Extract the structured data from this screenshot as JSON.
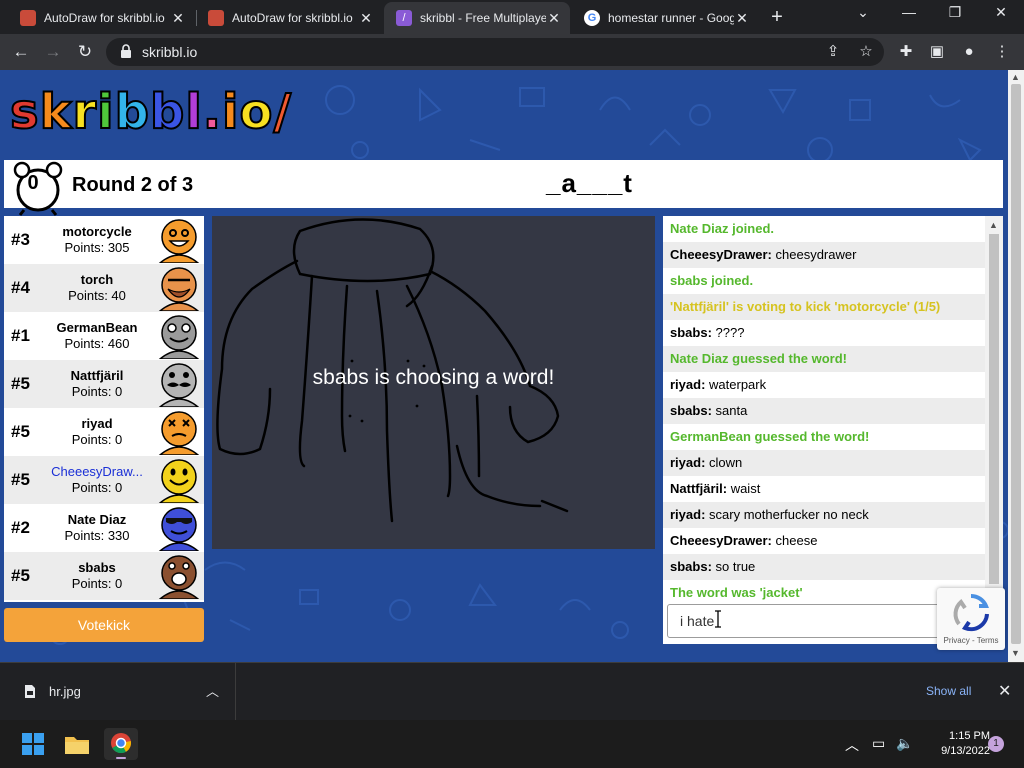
{
  "browser": {
    "tabs": [
      {
        "title": "AutoDraw for skribbl.io",
        "active": false
      },
      {
        "title": "AutoDraw for skribbl.io",
        "active": false
      },
      {
        "title": "skribbl - Free Multiplayer",
        "active": true
      },
      {
        "title": "homestar runner - Google",
        "active": false
      }
    ],
    "url": "skribbl.io"
  },
  "game": {
    "timer": "0",
    "round_text": "Round 2 of 3",
    "word_hint": "_a___t",
    "status_text": "sbabs is choosing a word!",
    "votekick_label": "Votekick",
    "chat_input_value": "i hate"
  },
  "players": [
    {
      "rank": "#3",
      "name": "motorcycle",
      "points": "Points: 305",
      "avatar_color": "#f59c2d",
      "avatar": "laughing-avatar"
    },
    {
      "rank": "#4",
      "name": "torch",
      "points": "Points: 40",
      "avatar_color": "#e8924a",
      "avatar": "bearded-avatar"
    },
    {
      "rank": "#1",
      "name": "GermanBean",
      "points": "Points: 460",
      "avatar_color": "#9a9a9a",
      "avatar": "grinning-avatar"
    },
    {
      "rank": "#5",
      "name": "Nattfjäril",
      "points": "Points: 0",
      "avatar_color": "#b4b4b4",
      "avatar": "mustache-avatar"
    },
    {
      "rank": "#5",
      "name": "riyad",
      "points": "Points: 0",
      "avatar_color": "#f59c2d",
      "avatar": "dizzy-avatar"
    },
    {
      "rank": "#5",
      "name": "CheeesyDraw...",
      "points": "Points: 0",
      "avatar_color": "#f2d21b",
      "avatar": "smiling-avatar",
      "self": true
    },
    {
      "rank": "#2",
      "name": "Nate Diaz",
      "points": "Points: 330",
      "avatar_color": "#3f4fd8",
      "avatar": "sunglasses-avatar"
    },
    {
      "rank": "#5",
      "name": "sbabs",
      "points": "Points: 0",
      "avatar_color": "#8b5030",
      "avatar": "shouting-avatar"
    }
  ],
  "chat": [
    {
      "type": "green",
      "text": "Nate Diaz joined."
    },
    {
      "type": "msg",
      "user": "CheeesyDrawer:",
      "text": "cheesydrawer"
    },
    {
      "type": "green",
      "text": "sbabs joined."
    },
    {
      "type": "yellow",
      "text": "'Nattfjäril' is voting to kick 'motorcycle' (1/5)"
    },
    {
      "type": "msg",
      "user": "sbabs:",
      "text": "????"
    },
    {
      "type": "green",
      "text": "Nate Diaz guessed the word!"
    },
    {
      "type": "msg",
      "user": "riyad:",
      "text": "waterpark"
    },
    {
      "type": "msg",
      "user": "sbabs:",
      "text": "santa"
    },
    {
      "type": "green",
      "text": "GermanBean guessed the word!"
    },
    {
      "type": "msg",
      "user": "riyad:",
      "text": "clown"
    },
    {
      "type": "msg",
      "user": "Nattfjäril:",
      "text": "waist"
    },
    {
      "type": "msg",
      "user": "riyad:",
      "text": "scary motherfucker no neck"
    },
    {
      "type": "msg",
      "user": "CheeesyDrawer:",
      "text": "cheese"
    },
    {
      "type": "msg",
      "user": "sbabs:",
      "text": "so true"
    },
    {
      "type": "green",
      "text": "The word was 'jacket'"
    }
  ],
  "recaptcha": {
    "terms": "Privacy - Terms"
  },
  "downloads": {
    "file": "hr.jpg",
    "show_all": "Show all"
  },
  "taskbar": {
    "time": "1:15 PM",
    "date": "9/13/2022",
    "notifications": "1"
  },
  "colors": {
    "page_bg": "#234a98",
    "canvas_bg": "#343744",
    "votekick": "#f4a33a",
    "chat_green": "#55b82d",
    "chat_yellow": "#d6c320"
  }
}
